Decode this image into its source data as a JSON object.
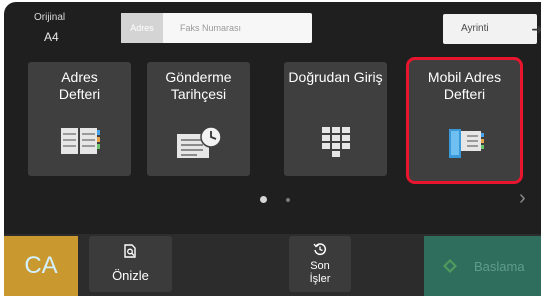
{
  "original": {
    "label": "Orijinal",
    "size": "A4"
  },
  "fax": {
    "address_button": "Adres",
    "number_placeholder": "Faks Numarası"
  },
  "detail": {
    "label": "Ayrinti"
  },
  "tiles": [
    {
      "label": "Adres\nDefteri",
      "icon": "address-book-icon"
    },
    {
      "label": "Gönderme\nTarihçesi",
      "icon": "send-history-icon"
    },
    {
      "label": "Doğrudan Giriş",
      "icon": "keypad-icon"
    },
    {
      "label": "Mobil Adres\nDefteri",
      "icon": "mobile-address-book-icon",
      "highlighted": true
    }
  ],
  "pagination": {
    "pages": 2,
    "current": 1
  },
  "bottom": {
    "ca_label": "CA",
    "preview_label": "Önizle",
    "jobs_label": "Son\nİşler",
    "start_label": "Baslama"
  },
  "colors": {
    "highlight": "#e8152f",
    "ca_button": "#c9982e",
    "start_button": "#2f6e5c"
  }
}
